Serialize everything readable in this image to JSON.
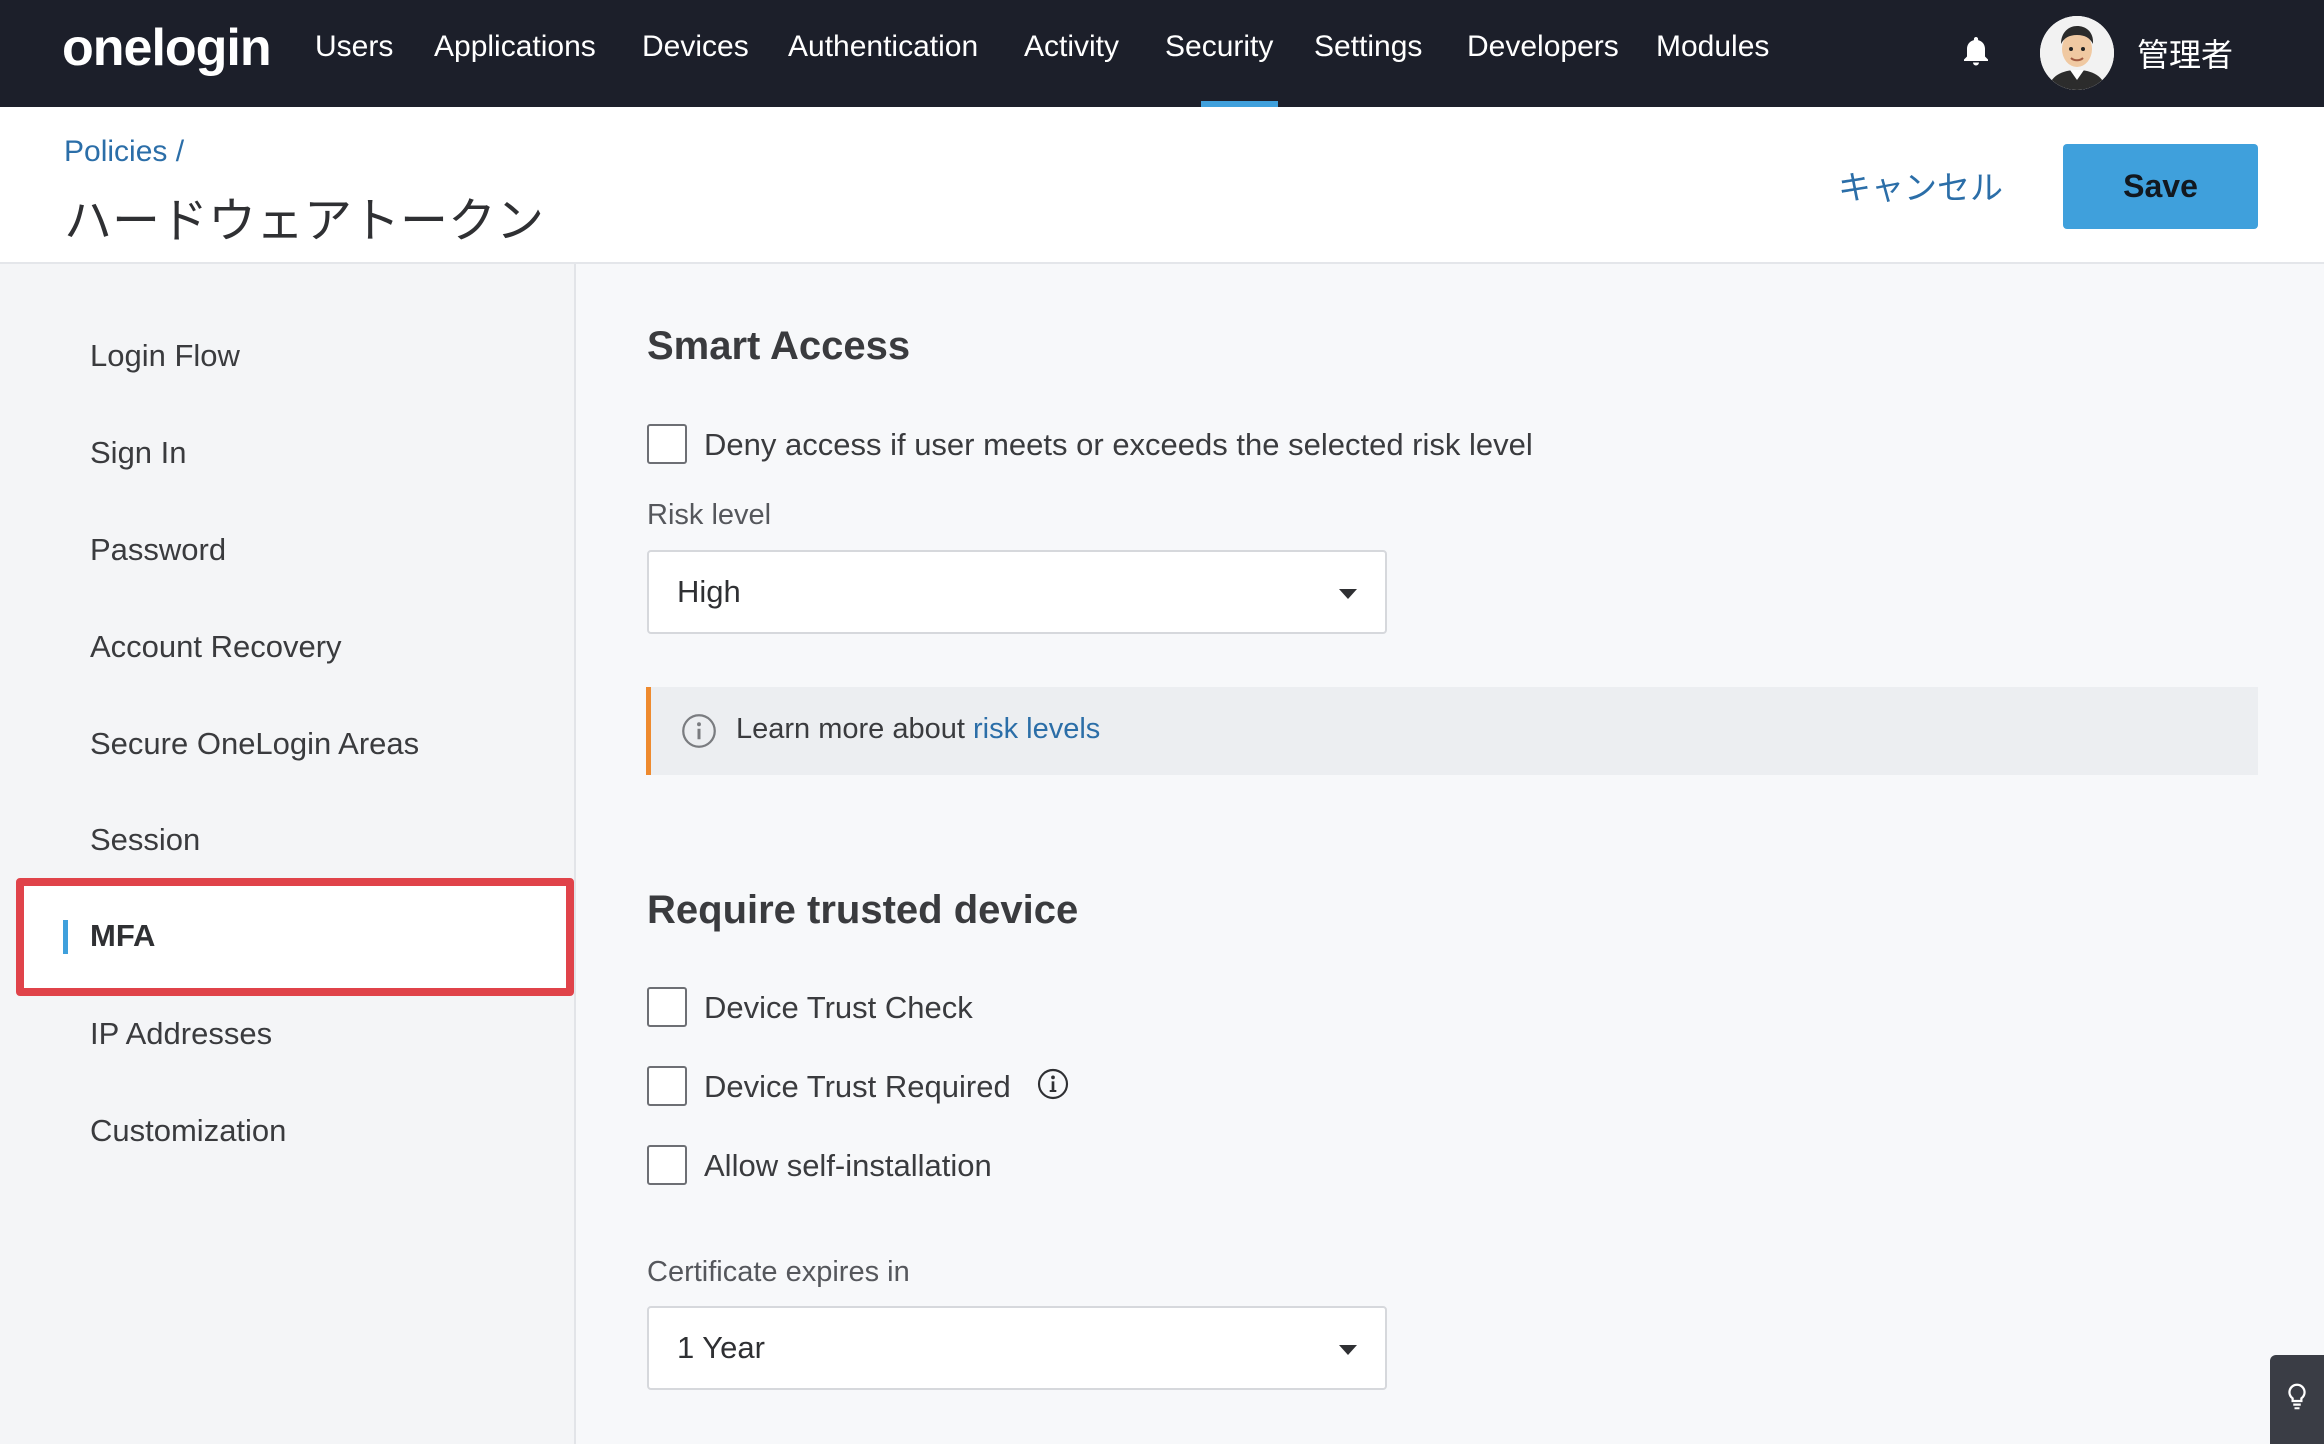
{
  "nav": {
    "logo": "onelogin",
    "items": [
      "Users",
      "Applications",
      "Devices",
      "Authentication",
      "Activity",
      "Security",
      "Settings",
      "Developers",
      "Modules"
    ],
    "active": "Security",
    "username": "管理者"
  },
  "header": {
    "breadcrumb": "Policies /",
    "title": "ハードウェアトークン",
    "cancel_label": "キャンセル",
    "save_label": "Save"
  },
  "sidebar": {
    "items": [
      {
        "label": "Login Flow"
      },
      {
        "label": "Sign In"
      },
      {
        "label": "Password"
      },
      {
        "label": "Account Recovery"
      },
      {
        "label": "Secure OneLogin Areas"
      },
      {
        "label": "Session"
      },
      {
        "label": "MFA"
      },
      {
        "label": "IP Addresses"
      },
      {
        "label": "Customization"
      }
    ],
    "selected": "MFA"
  },
  "smart_access": {
    "heading": "Smart Access",
    "deny_label": "Deny access if user meets or exceeds the selected risk level",
    "deny_checked": false,
    "risk_label": "Risk level",
    "risk_value": "High",
    "info_text": "Learn more about ",
    "info_link": "risk levels"
  },
  "trusted_device": {
    "heading": "Require trusted device",
    "options": [
      {
        "label": "Device Trust Check",
        "checked": false
      },
      {
        "label": "Device Trust Required",
        "checked": false
      },
      {
        "label": "Allow self-installation",
        "checked": false
      }
    ],
    "cert_label": "Certificate expires in",
    "cert_value": "1 Year"
  },
  "colors": {
    "nav_bg": "#1c1f2a",
    "accent": "#3fa0dc",
    "link": "#2b6ea8",
    "highlight_box": "#e0434a",
    "info_border": "#ee8a2e"
  }
}
